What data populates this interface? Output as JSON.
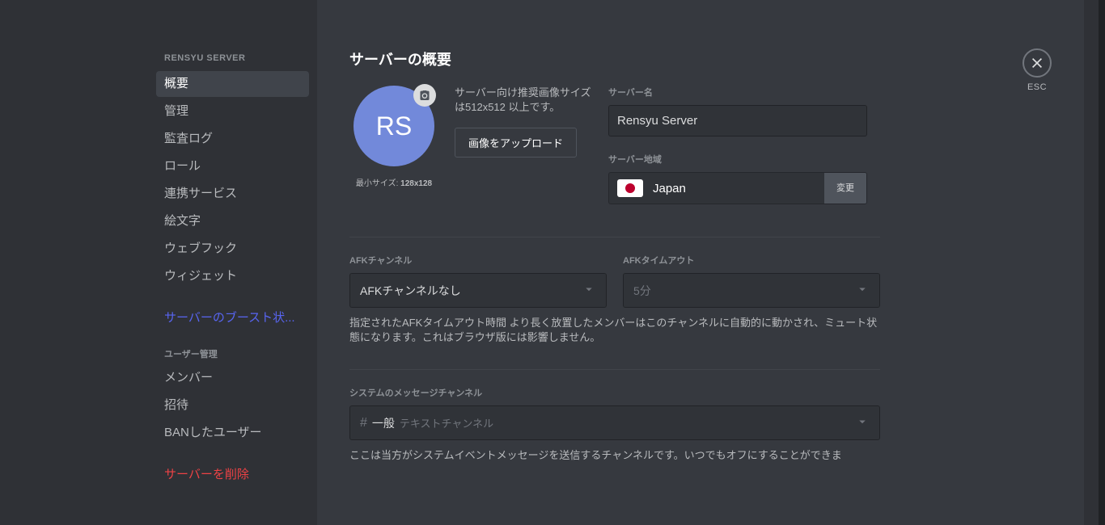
{
  "sidebar": {
    "header": "RENSYU SERVER",
    "items": [
      {
        "label": "概要",
        "selected": true
      },
      {
        "label": "管理"
      },
      {
        "label": "監査ログ"
      },
      {
        "label": "ロール"
      },
      {
        "label": "連携サービス"
      },
      {
        "label": "絵文字"
      },
      {
        "label": "ウェブフック"
      },
      {
        "label": "ウィジェット"
      }
    ],
    "boost": "サーバーのブースト状...",
    "user_mgmt_header": "ユーザー管理",
    "user_mgmt_items": [
      {
        "label": "メンバー"
      },
      {
        "label": "招待"
      },
      {
        "label": "BANしたユーザー"
      }
    ],
    "delete": "サーバーを削除"
  },
  "close": {
    "label": "ESC"
  },
  "page_title": "サーバーの概要",
  "icon": {
    "initials": "RS",
    "min_size_label": "最小サイズ:",
    "min_size_value": "128x128",
    "recommendation": "サーバー向け推奨画像サイズは512x512 以上です。",
    "upload_button": "画像をアップロード"
  },
  "server_name": {
    "label": "サーバー名",
    "value": "Rensyu Server"
  },
  "server_region": {
    "label": "サーバー地域",
    "value": "Japan",
    "change_button": "変更"
  },
  "afk_channel": {
    "label": "AFKチャンネル",
    "value": "AFKチャンネルなし"
  },
  "afk_timeout": {
    "label": "AFKタイムアウト",
    "value": "5分"
  },
  "afk_help": "指定されたAFKタイムアウト時間 より長く放置したメンバーはこのチャンネルに自動的に動かされ、ミュート状態になります。これはブラウザ版には影響しません。",
  "system_channel": {
    "label": "システムのメッセージチャンネル",
    "name": "一般",
    "hint": "テキストチャンネル"
  },
  "system_help": "ここは当方がシステムイベントメッセージを送信するチャンネルです。いつでもオフにすることができま"
}
